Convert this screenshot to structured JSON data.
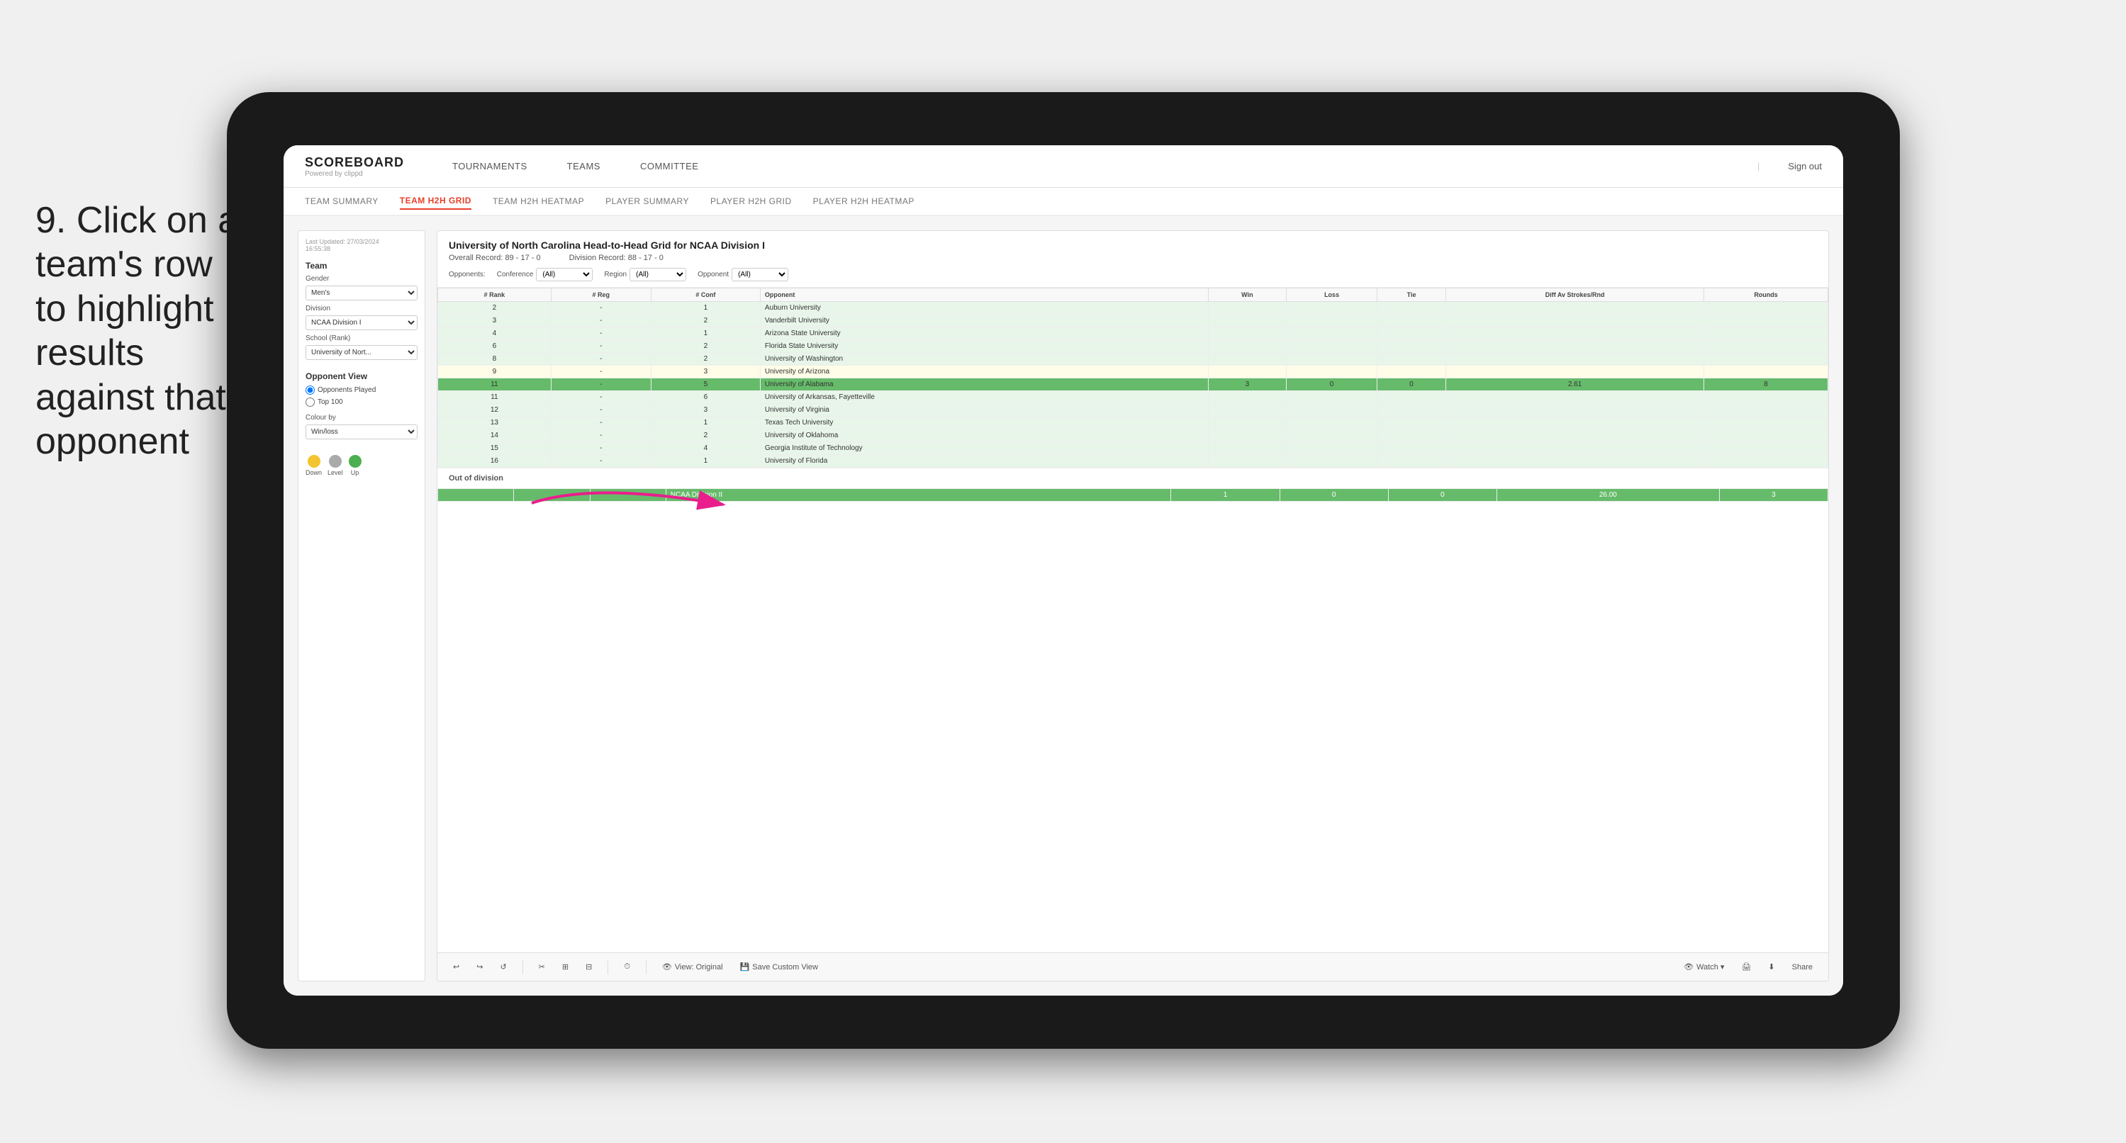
{
  "instruction": {
    "step": "9.",
    "text": "Click on a team's row to highlight results against that opponent"
  },
  "nav": {
    "logo": "SCOREBOARD",
    "logo_sub": "Powered by clippd",
    "items": [
      "TOURNAMENTS",
      "TEAMS",
      "COMMITTEE"
    ],
    "separator": "|",
    "sign_out": "Sign out"
  },
  "sub_nav": {
    "items": [
      "TEAM SUMMARY",
      "TEAM H2H GRID",
      "TEAM H2H HEATMAP",
      "PLAYER SUMMARY",
      "PLAYER H2H GRID",
      "PLAYER H2H HEATMAP"
    ],
    "active": "TEAM H2H GRID"
  },
  "left_panel": {
    "last_updated_label": "Last Updated: 27/03/2024",
    "last_updated_time": "16:55:38",
    "team_label": "Team",
    "gender_label": "Gender",
    "gender_value": "Men's",
    "division_label": "Division",
    "division_value": "NCAA Division I",
    "school_label": "School (Rank)",
    "school_value": "University of Nort...",
    "opponent_view_label": "Opponent View",
    "radio_opponents": "Opponents Played",
    "radio_top100": "Top 100",
    "colour_by_label": "Colour by",
    "colour_value": "Win/loss",
    "legend": {
      "down_label": "Down",
      "down_color": "#f4c430",
      "level_label": "Level",
      "level_color": "#aaa",
      "up_label": "Up",
      "up_color": "#4caf50"
    }
  },
  "grid": {
    "title": "University of North Carolina Head-to-Head Grid for NCAA Division I",
    "overall_record": "Overall Record: 89 - 17 - 0",
    "division_record": "Division Record: 88 - 17 - 0",
    "filters": {
      "opponents_label": "Opponents:",
      "conference_label": "Conference",
      "conference_value": "(All)",
      "region_label": "Region",
      "region_value": "(All)",
      "opponent_label": "Opponent",
      "opponent_value": "(All)"
    },
    "columns": [
      "# Rank",
      "# Reg",
      "# Conf",
      "Opponent",
      "Win",
      "Loss",
      "Tie",
      "Diff Av Strokes/Rnd",
      "Rounds"
    ],
    "rows": [
      {
        "rank": "2",
        "reg": "-",
        "conf": "1",
        "opponent": "Auburn University",
        "win": "",
        "loss": "",
        "tie": "",
        "diff": "",
        "rounds": "",
        "color": "light-green"
      },
      {
        "rank": "3",
        "reg": "-",
        "conf": "2",
        "opponent": "Vanderbilt University",
        "win": "",
        "loss": "",
        "tie": "",
        "diff": "",
        "rounds": "",
        "color": "light-green"
      },
      {
        "rank": "4",
        "reg": "-",
        "conf": "1",
        "opponent": "Arizona State University",
        "win": "",
        "loss": "",
        "tie": "",
        "diff": "",
        "rounds": "",
        "color": "light-green"
      },
      {
        "rank": "6",
        "reg": "-",
        "conf": "2",
        "opponent": "Florida State University",
        "win": "",
        "loss": "",
        "tie": "",
        "diff": "",
        "rounds": "",
        "color": "light-green"
      },
      {
        "rank": "8",
        "reg": "-",
        "conf": "2",
        "opponent": "University of Washington",
        "win": "",
        "loss": "",
        "tie": "",
        "diff": "",
        "rounds": "",
        "color": "light-green"
      },
      {
        "rank": "9",
        "reg": "-",
        "conf": "3",
        "opponent": "University of Arizona",
        "win": "",
        "loss": "",
        "tie": "",
        "diff": "",
        "rounds": "",
        "color": "light-yellow"
      },
      {
        "rank": "11",
        "reg": "-",
        "conf": "5",
        "opponent": "University of Alabama",
        "win": "3",
        "loss": "0",
        "tie": "0",
        "diff": "2.61",
        "rounds": "8",
        "color": "selected"
      },
      {
        "rank": "11",
        "reg": "-",
        "conf": "6",
        "opponent": "University of Arkansas, Fayetteville",
        "win": "",
        "loss": "",
        "tie": "",
        "diff": "",
        "rounds": "",
        "color": "light-green"
      },
      {
        "rank": "12",
        "reg": "-",
        "conf": "3",
        "opponent": "University of Virginia",
        "win": "",
        "loss": "",
        "tie": "",
        "diff": "",
        "rounds": "",
        "color": "light-green"
      },
      {
        "rank": "13",
        "reg": "-",
        "conf": "1",
        "opponent": "Texas Tech University",
        "win": "",
        "loss": "",
        "tie": "",
        "diff": "",
        "rounds": "",
        "color": "light-green"
      },
      {
        "rank": "14",
        "reg": "-",
        "conf": "2",
        "opponent": "University of Oklahoma",
        "win": "",
        "loss": "",
        "tie": "",
        "diff": "",
        "rounds": "",
        "color": "light-green"
      },
      {
        "rank": "15",
        "reg": "-",
        "conf": "4",
        "opponent": "Georgia Institute of Technology",
        "win": "",
        "loss": "",
        "tie": "",
        "diff": "",
        "rounds": "",
        "color": "light-green"
      },
      {
        "rank": "16",
        "reg": "-",
        "conf": "1",
        "opponent": "University of Florida",
        "win": "",
        "loss": "",
        "tie": "",
        "diff": "",
        "rounds": "",
        "color": "light-green"
      }
    ],
    "out_of_division_label": "Out of division",
    "out_of_division_row": {
      "label": "NCAA Division II",
      "win": "1",
      "loss": "0",
      "tie": "0",
      "diff": "26.00",
      "rounds": "3"
    }
  },
  "toolbar": {
    "undo": "↩",
    "redo": "↪",
    "view_original": "View: Original",
    "save_custom": "Save Custom View",
    "watch": "Watch ▾",
    "share": "Share"
  }
}
